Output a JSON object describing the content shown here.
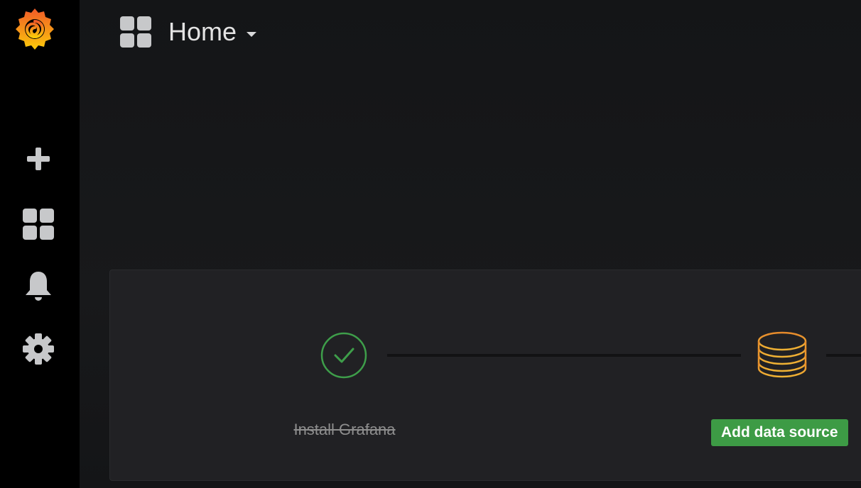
{
  "sidebar": {
    "logo": "grafana-logo",
    "items": [
      {
        "icon": "plus-icon",
        "label": "Create"
      },
      {
        "icon": "dashboard-grid-icon",
        "label": "Dashboards"
      },
      {
        "icon": "bell-icon",
        "label": "Alerting"
      },
      {
        "icon": "gear-icon",
        "label": "Configuration"
      }
    ]
  },
  "header": {
    "icon": "dashboard-grid-icon",
    "title": "Home"
  },
  "getting_started": {
    "steps": [
      {
        "icon": "check-circle-icon",
        "label": "Install Grafana",
        "status": "done"
      },
      {
        "icon": "database-icon",
        "label": "Add data source",
        "status": "active"
      }
    ]
  },
  "colors": {
    "accent_green": "#3d9b45",
    "check_green": "#3e9e4a",
    "database_orange": "#e08a2a",
    "sidebar_bg": "#000000",
    "panel_bg": "#212124"
  }
}
